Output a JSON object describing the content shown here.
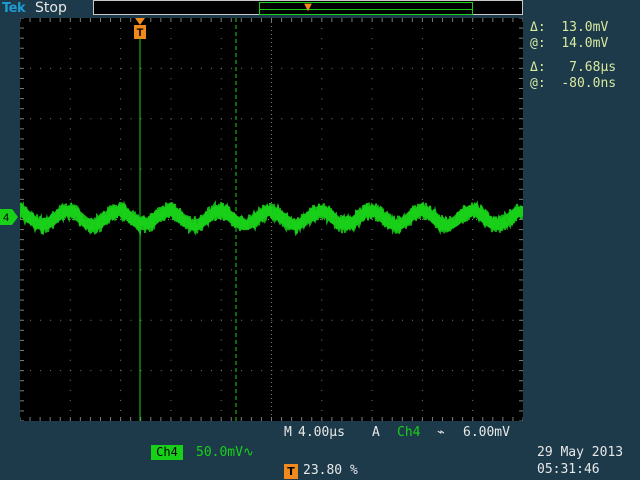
{
  "header": {
    "brand": "Tek",
    "state": "Stop"
  },
  "cursor_readouts": {
    "voltage_delta_symbol": "Δ:",
    "voltage_delta": "13.0mV",
    "voltage_at_symbol": "@:",
    "voltage_at": "14.0mV",
    "time_delta_symbol": "Δ:",
    "time_delta": "7.68µs",
    "time_at_symbol": "@:",
    "time_at": "-80.0ns"
  },
  "horizontal": {
    "label": "M",
    "scale": "4.00µs"
  },
  "trigger": {
    "mode": "A",
    "source": "Ch4",
    "slope_symbol": "⌁",
    "level": "6.00mV",
    "position_marker": "T",
    "position": "23.80 %"
  },
  "channel": {
    "label": "Ch4",
    "scale": "50.0mV",
    "coupling_symbol": "∿",
    "marker_label": "4"
  },
  "timestamp": {
    "date": "29 May 2013",
    "time": "05:31:46"
  },
  "colors": {
    "background": "#1c3a4a",
    "trace": "#19d019",
    "trigger": "#f08a1c",
    "brand": "#1f9bd1",
    "readout": "#d8e8a0"
  },
  "icons": {
    "trigger_marker": "trigger-arrow-icon",
    "channel_marker": "channel-ground-marker-icon"
  }
}
